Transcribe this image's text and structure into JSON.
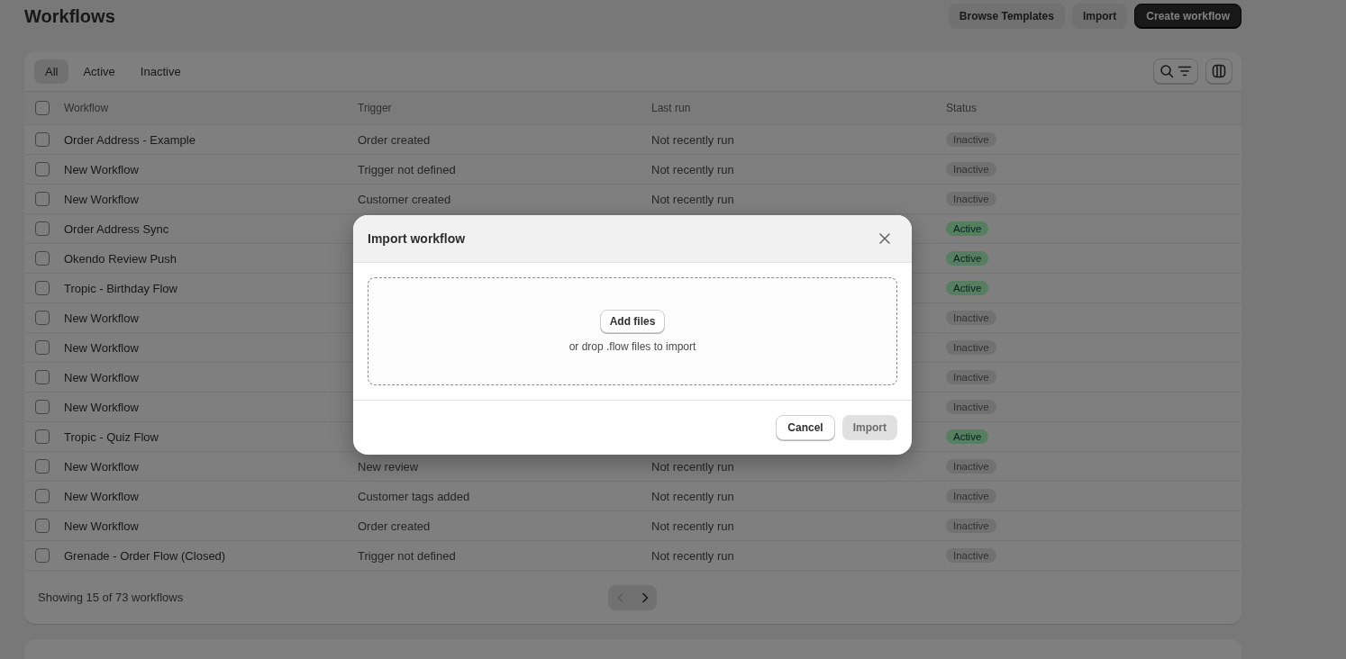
{
  "page": {
    "title": "Workflows",
    "actions": [
      {
        "label": "Browse Templates",
        "kind": "secondary"
      },
      {
        "label": "Import",
        "kind": "secondary"
      },
      {
        "label": "Create workflow",
        "kind": "primary"
      }
    ]
  },
  "tabs": [
    {
      "label": "All",
      "selected": true
    },
    {
      "label": "Active",
      "selected": false
    },
    {
      "label": "Inactive",
      "selected": false
    }
  ],
  "table": {
    "select_all_checked": false,
    "columns": [
      "Workflow",
      "Trigger",
      "Last run",
      "Status"
    ],
    "rows": [
      {
        "checked": false,
        "workflow": "Order Address - Example",
        "trigger": "Order created",
        "last_run": "Not recently run",
        "status": "Inactive",
        "active": false
      },
      {
        "checked": false,
        "workflow": "New Workflow",
        "trigger": "Trigger not defined",
        "last_run": "Not recently run",
        "status": "Inactive",
        "active": false
      },
      {
        "checked": false,
        "workflow": "New Workflow",
        "trigger": "Customer created",
        "last_run": "Not recently run",
        "status": "Inactive",
        "active": false
      },
      {
        "checked": false,
        "workflow": "Order Address Sync",
        "status": "Active",
        "active": true
      },
      {
        "checked": false,
        "workflow": "Okendo Review Push",
        "status": "Active",
        "active": true
      },
      {
        "checked": false,
        "workflow": "Tropic - Birthday Flow",
        "status": "Active",
        "active": true
      },
      {
        "checked": false,
        "workflow": "New Workflow",
        "status": "Inactive",
        "active": false
      },
      {
        "checked": false,
        "workflow": "New Workflow",
        "status": "Inactive",
        "active": false
      },
      {
        "checked": false,
        "workflow": "New Workflow",
        "status": "Inactive",
        "active": false
      },
      {
        "checked": false,
        "workflow": "New Workflow",
        "status": "Inactive",
        "active": false
      },
      {
        "checked": false,
        "workflow": "Tropic - Quiz Flow",
        "status": "Active",
        "active": true
      },
      {
        "checked": false,
        "workflow": "New Workflow",
        "trigger": "New review",
        "last_run": "Not recently run",
        "status": "Inactive",
        "active": false
      },
      {
        "checked": false,
        "workflow": "New Workflow",
        "trigger": "Customer tags added",
        "last_run": "Not recently run",
        "status": "Inactive",
        "active": false
      },
      {
        "checked": false,
        "workflow": "New Workflow",
        "trigger": "Order created",
        "last_run": "Not recently run",
        "status": "Inactive",
        "active": false
      },
      {
        "checked": false,
        "workflow": "Grenade - Order Flow (Closed)",
        "trigger": "Trigger not defined",
        "last_run": "Not recently run",
        "status": "Inactive",
        "active": false
      }
    ],
    "footer": "Showing 15 of 73 workflows",
    "pagination": {
      "previous_disabled": true,
      "next_disabled": false
    }
  },
  "modal": {
    "title": "Import workflow",
    "add_files": "Add files",
    "drop_hint": "or drop .flow files to import",
    "buttons": [
      {
        "label": "Cancel",
        "disabled": false,
        "kind": "secondary"
      },
      {
        "label": "Import",
        "disabled": true,
        "kind": "primary"
      }
    ]
  }
}
